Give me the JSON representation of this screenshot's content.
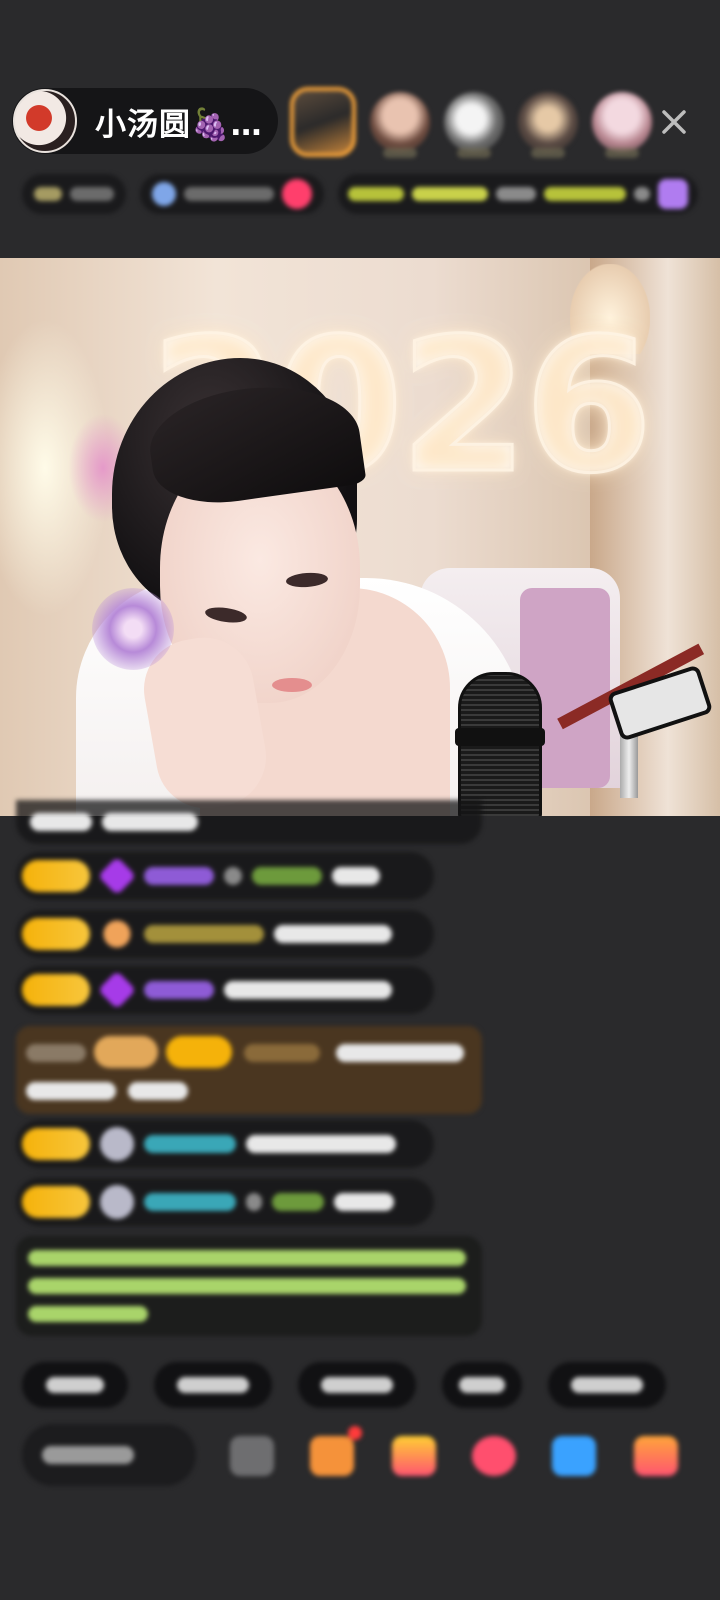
{
  "header": {
    "host_name": "小汤圆🍇…",
    "icons": {
      "host_avatar": "host-avatar",
      "close": "close-icon"
    },
    "viewers": [
      "viewer-avatar-1",
      "viewer-avatar-2",
      "viewer-avatar-3",
      "viewer-avatar-4",
      "viewer-avatar-5"
    ]
  },
  "video": {
    "background_lights_text": "2026"
  },
  "colors": {
    "background": "#2a2a2c",
    "level_badge": "#f5b20a",
    "system_notice_text": "#a9d46a",
    "welcome_banner": "#4a3620",
    "top_viewer_border": "#f2a13a"
  }
}
